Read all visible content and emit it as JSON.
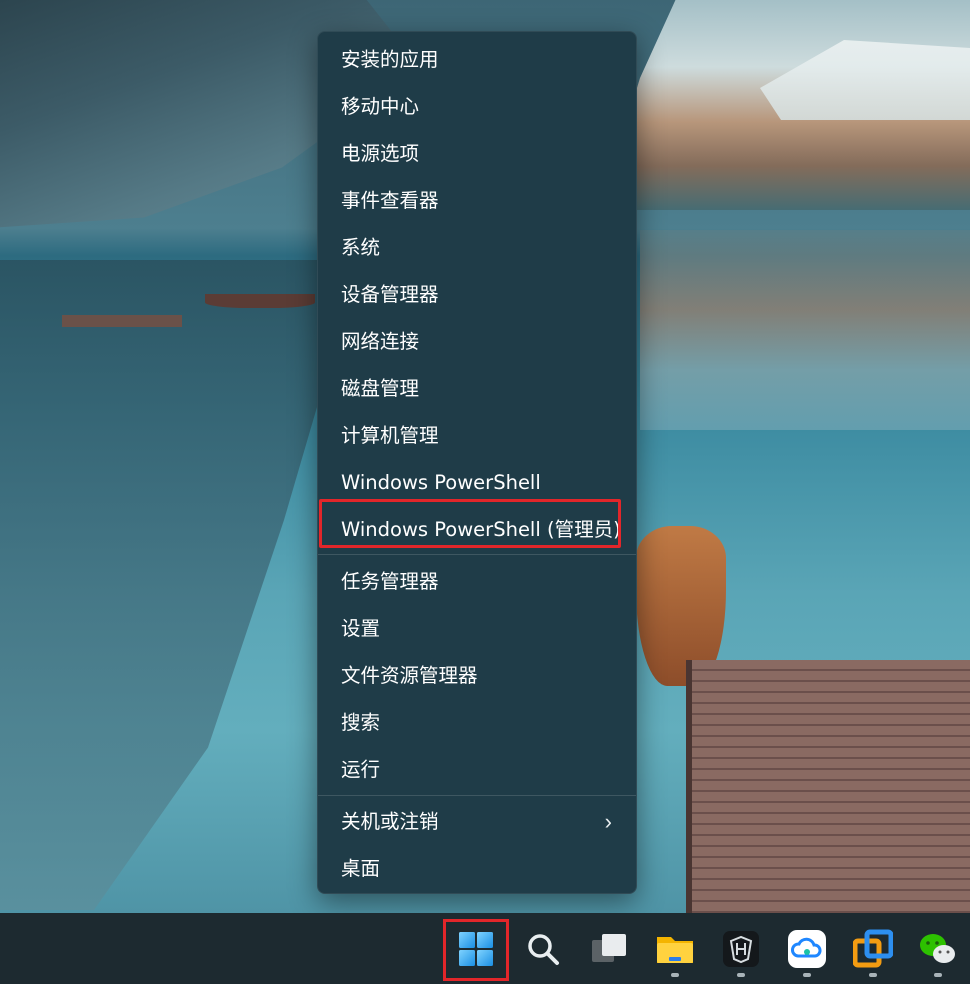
{
  "menu": {
    "items": [
      {
        "label": "安装的应用"
      },
      {
        "label": "移动中心"
      },
      {
        "label": "电源选项"
      },
      {
        "label": "事件查看器"
      },
      {
        "label": "系统"
      },
      {
        "label": "设备管理器"
      },
      {
        "label": "网络连接"
      },
      {
        "label": "磁盘管理"
      },
      {
        "label": "计算机管理"
      },
      {
        "label": "Windows PowerShell"
      },
      {
        "label": "Windows PowerShell (管理员)"
      },
      {
        "label": "任务管理器"
      },
      {
        "label": "设置"
      },
      {
        "label": "文件资源管理器"
      },
      {
        "label": "搜索"
      },
      {
        "label": "运行"
      },
      {
        "label": "关机或注销",
        "has_submenu": true
      },
      {
        "label": "桌面"
      }
    ],
    "submenu_glyph": "›"
  },
  "taskbar": {
    "icons": [
      {
        "name": "start-icon"
      },
      {
        "name": "search-icon"
      },
      {
        "name": "task-view-icon"
      },
      {
        "name": "file-explorer-icon"
      },
      {
        "name": "game-app-icon"
      },
      {
        "name": "cloud-drive-icon"
      },
      {
        "name": "remote-desktop-icon"
      },
      {
        "name": "wechat-icon"
      }
    ]
  },
  "colors": {
    "menu_bg": "#1f3c48",
    "highlight_border": "#e2262a",
    "taskbar_bg": "#1d2a30",
    "text": "#ffffff"
  }
}
